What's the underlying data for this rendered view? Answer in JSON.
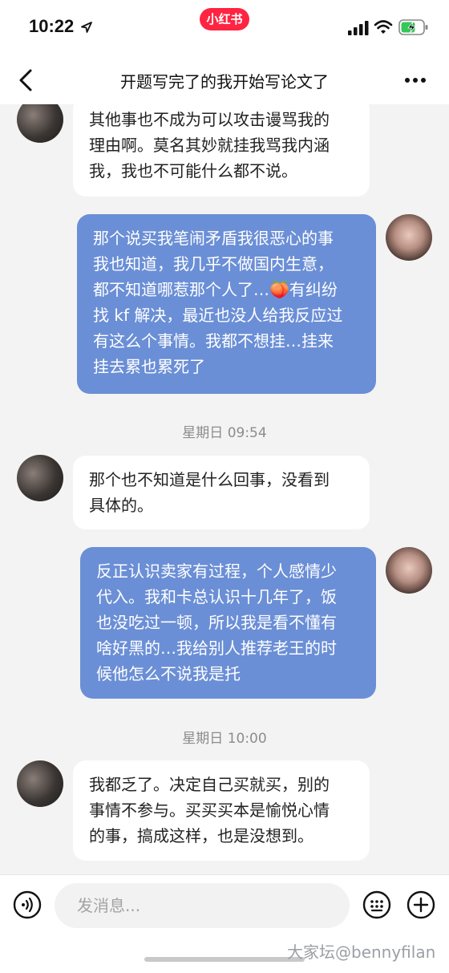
{
  "status_bar": {
    "time": "10:22",
    "app_badge": "小红书",
    "icons": [
      "location-arrow-icon",
      "signal-icon",
      "wifi-icon",
      "battery-charging-icon"
    ]
  },
  "nav": {
    "title": "开题写完了的我开始写论文了",
    "icons": [
      "back-chevron-icon",
      "more-dots-icon"
    ]
  },
  "messages": [
    {
      "side": "in",
      "text": "其他事也不成为可以攻击谩骂我的\n理由啊。莫名其妙就挂我骂我内涵\n我，我也不可能什么都不说。"
    },
    {
      "side": "out",
      "text": "那个说买我笔闹矛盾我很恶心的事\n我也知道，我几乎不做国内生意，\n都不知道哪惹那个人了…🍑有纠纷\n找 kf 解决，最近也没人给我反应过\n有这么个事情。我都不想挂…挂来\n挂去累也累死了"
    },
    {
      "side": "time",
      "text": "星期日 09:54"
    },
    {
      "side": "in",
      "text": "那个也不知道是什么回事，没看到\n具体的。"
    },
    {
      "side": "out",
      "text": "反正认识卖家有过程，个人感情少\n代入。我和卡总认识十几年了，饭\n也没吃过一顿，所以我是看不懂有\n啥好黑的…我给别人推荐老王的时\n候他怎么不说我是托"
    },
    {
      "side": "time",
      "text": "星期日 10:00"
    },
    {
      "side": "in",
      "text": "我都乏了。决定自己买就买，别的\n事情不参与。买买买本是愉悦心情\n的事，搞成这样，也是没想到。"
    }
  ],
  "input": {
    "placeholder": "发消息...",
    "icons": [
      "voice-icon",
      "emoji-icon",
      "plus-icon"
    ]
  },
  "watermark": "大家坛@bennyfilan",
  "colors": {
    "brand": "#ff2442",
    "outgoing_bubble": "#6b8fd6",
    "incoming_bubble": "#ffffff",
    "background": "#f3f3f3"
  }
}
